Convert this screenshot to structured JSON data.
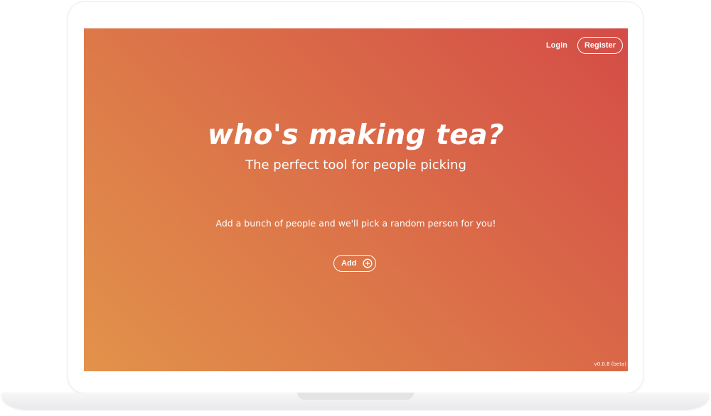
{
  "nav": {
    "login_label": "Login",
    "register_label": "Register"
  },
  "hero": {
    "title": "who's making tea?",
    "subtitle": "The perfect tool for people picking",
    "description": "Add a bunch of people and we'll pick a random person for you!",
    "add_label": "Add",
    "add_icon": "plus-circle-icon"
  },
  "footer": {
    "version": "v0.0.8 (beta)"
  },
  "colors": {
    "gradient_start": "#e2924a",
    "gradient_mid": "#dc7449",
    "gradient_end": "#d44c47",
    "text": "#ffffff"
  }
}
